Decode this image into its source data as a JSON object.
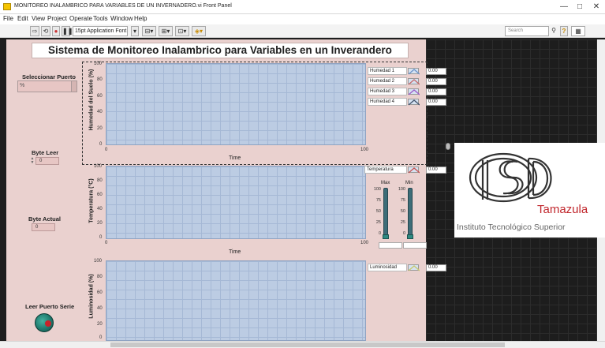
{
  "window": {
    "title": "MONITOREO INALAMBRICO PARA VARIABLES DE UN INVERNADERO.vi Front Panel",
    "minimize": "—",
    "maximize": "□",
    "close": "✕"
  },
  "menu": [
    "File",
    "Edit",
    "View",
    "Project",
    "Operate",
    "Tools",
    "Window",
    "Help"
  ],
  "toolbar": {
    "font": "15pt Application Font",
    "search_placeholder": "Search",
    "run_icon": "run-arrow-icon",
    "run_cont_icon": "run-continuously-icon",
    "abort_icon": "abort-icon",
    "pause_icon": "pause-icon"
  },
  "panel": {
    "title": "Sistema de Monitoreo Inalambrico para Variables en un Inverandero",
    "controls": {
      "port_label": "Seleccionar Puerto",
      "port_glyph": "%",
      "byte_leer_label": "Byte Leer",
      "byte_leer_value": "0",
      "byte_actual_label": "Byte Actual",
      "byte_actual_value": "0",
      "leer_puerto_label": "Leer Puerto Serie"
    }
  },
  "chart_data": [
    {
      "type": "line",
      "ylabel": "Humedad del Suelo (%)",
      "xlabel": "Time",
      "ylim": [
        0,
        100
      ],
      "xlim": [
        0,
        100
      ],
      "yticks": [
        "100",
        "80",
        "60",
        "40",
        "20",
        "0"
      ],
      "xticks": [
        "0",
        "100"
      ],
      "series": [
        {
          "name": "Humedad 1",
          "value": "0.00",
          "color": "#6c93c9"
        },
        {
          "name": "Humedad 2",
          "value": "0.00",
          "color": "#c76a6a"
        },
        {
          "name": "Humedad 3",
          "value": "0.00",
          "color": "#9b59c7"
        },
        {
          "name": "Humedad 4",
          "value": "0.00",
          "color": "#40506b"
        }
      ]
    },
    {
      "type": "line",
      "ylabel": "Temperatura (°C)",
      "xlabel": "Time",
      "ylim": [
        0,
        100
      ],
      "xlim": [
        0,
        100
      ],
      "yticks": [
        "100",
        "80",
        "60",
        "40",
        "20",
        "0"
      ],
      "xticks": [
        "0",
        "100"
      ],
      "series": [
        {
          "name": "Temperatura",
          "value": "0.00",
          "color": "#c9504e"
        }
      ],
      "thermometers": [
        {
          "label": "Max",
          "scale": [
            "100",
            "75",
            "50",
            "25",
            "0"
          ],
          "value": 0
        },
        {
          "label": "Min",
          "scale": [
            "100",
            "75",
            "50",
            "25",
            "0"
          ],
          "value": 0
        }
      ]
    },
    {
      "type": "line",
      "ylabel": "Luminosidad (%)",
      "xlabel": "",
      "ylim": [
        0,
        100
      ],
      "yticks": [
        "100",
        "80",
        "60",
        "40",
        "20",
        "0"
      ],
      "series": [
        {
          "name": "Luminosidad",
          "value": "0.00",
          "color": "#c8c86a"
        }
      ]
    }
  ],
  "logo": {
    "name": "Tamazula",
    "subtitle": "Instituto Tecnológico Superior"
  },
  "colors": {
    "panel_bg": "#ead1cf",
    "plot_bg": "#bccce3",
    "dark_bg": "#1d1d1d",
    "logo_red": "#c1272d"
  }
}
